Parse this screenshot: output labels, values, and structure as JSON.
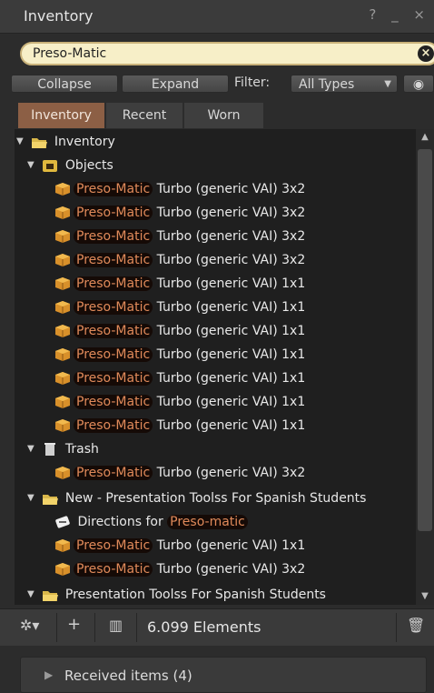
{
  "window": {
    "title": "Inventory",
    "title_icons": "? _ ×"
  },
  "search": {
    "value": "Preso-Matic",
    "clear_icon": "close-icon"
  },
  "toolbar": {
    "collapse": "Collapse",
    "expand": "Expand",
    "filter_label": "Filter:",
    "filter_value": "All Types"
  },
  "tabs": [
    {
      "label": "Inventory"
    },
    {
      "label": "Recent"
    },
    {
      "label": "Worn"
    }
  ],
  "tree": {
    "root": "Inventory",
    "objects_folder": "Objects",
    "trash_folder": "Trash",
    "new_folder": "New - Presentation Toolss For Spanish Students",
    "pres_folder": "Presentation Toolss For Spanish Students",
    "directions_prefix": "Directions for ",
    "directions_highlight": "Preso-matic",
    "highlight": "Preso-Matic",
    "objects_items": [
      " Turbo (generic VAI) 3x2",
      " Turbo (generic VAI) 3x2",
      " Turbo (generic VAI) 3x2",
      " Turbo (generic VAI) 3x2",
      " Turbo (generic VAI) 1x1",
      " Turbo (generic VAI) 1x1",
      " Turbo (generic VAI) 1x1",
      " Turbo (generic VAI) 1x1",
      " Turbo (generic VAI) 1x1",
      " Turbo (generic VAI) 1x1",
      " Turbo (generic VAI) 1x1"
    ],
    "trash_items": [
      " Turbo (generic VAI) 3x2"
    ],
    "new_items": [
      " Turbo (generic VAI) 1x1",
      " Turbo (generic VAI) 3x2"
    ]
  },
  "bottom": {
    "count": "6.099 Elements"
  },
  "received": {
    "label": "Received items (4)"
  }
}
